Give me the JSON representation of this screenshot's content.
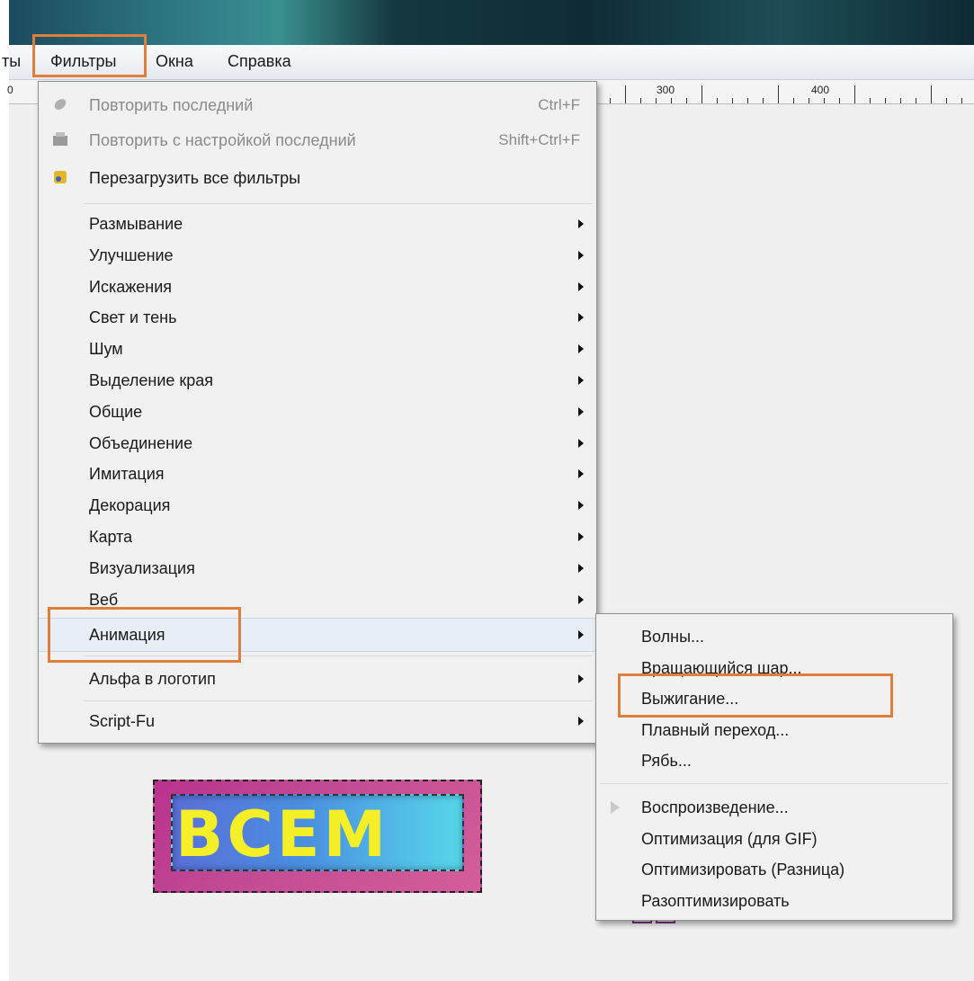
{
  "menubar": {
    "partial_left": "ты",
    "items": [
      "Фильтры",
      "Окна",
      "Справка"
    ]
  },
  "ruler": {
    "left_label": "0",
    "labels": [
      "300",
      "400"
    ]
  },
  "filters_menu": {
    "top_items": [
      {
        "label": "Повторить последний",
        "shortcut": "Ctrl+F",
        "disabled": true,
        "icon": "repeat-icon"
      },
      {
        "label": "Повторить с настройкой последний",
        "shortcut": "Shift+Ctrl+F",
        "disabled": true,
        "icon": "reshow-icon"
      },
      {
        "label": "Перезагрузить все фильтры",
        "shortcut": "",
        "disabled": false,
        "icon": "refresh-icon"
      }
    ],
    "submenus": [
      "Размывание",
      "Улучшение",
      "Искажения",
      "Свет и тень",
      "Шум",
      "Выделение края",
      "Общие",
      "Объединение",
      "Имитация",
      "Декорация",
      "Карта",
      "Визуализация",
      "Веб",
      "Анимация"
    ],
    "lower_items": [
      "Альфа в логотип",
      "Script-Fu"
    ],
    "active_item": "Анимация"
  },
  "animation_submenu": {
    "group1": [
      "Волны...",
      "Вращающийся шар...",
      "Выжигание...",
      "Плавный переход...",
      "Рябь..."
    ],
    "group2": [
      "Воспроизведение...",
      "Оптимизация (для GIF)",
      "Оптимизировать (Разница)",
      "Разоптимизировать"
    ],
    "highlighted": "Выжигание..."
  },
  "canvas": {
    "logo_text": "BCEM"
  },
  "colors": {
    "highlight_box": "#e07f3a",
    "logo_text": "#f4ef27"
  }
}
